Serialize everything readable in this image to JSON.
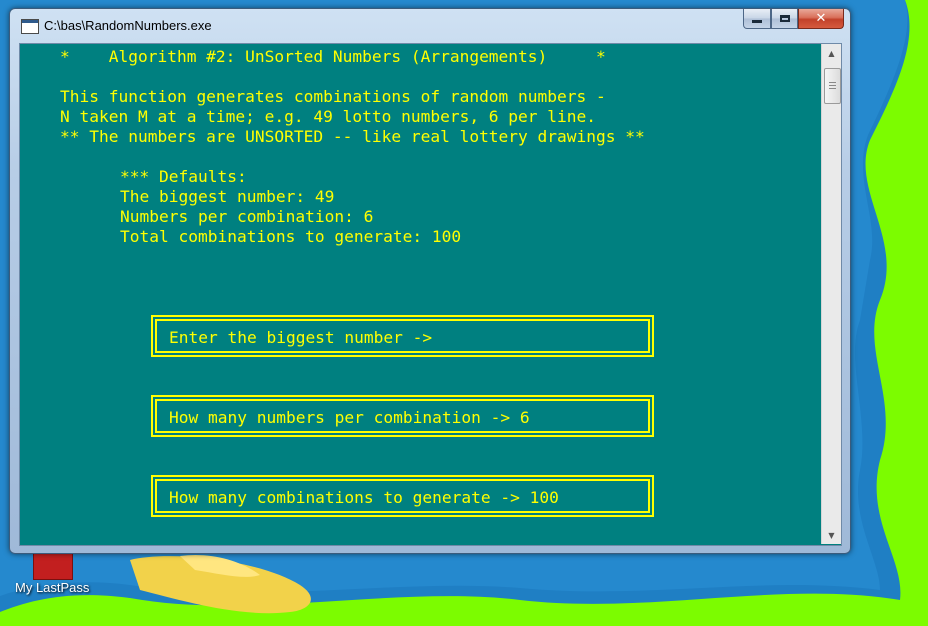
{
  "window": {
    "title": "C:\\bas\\RandomNumbers.exe",
    "close_glyph": "✕",
    "icons": [
      "console-app-icon",
      "minimize-icon",
      "maximize-icon",
      "close-icon"
    ]
  },
  "console": {
    "background": "#008080",
    "text_color": "#ffff00",
    "lines": {
      "header": "*    Algorithm #2: UnSorted Numbers (Arrangements)     *",
      "desc1": "This function generates combinations of random numbers -",
      "desc2": "N taken M at a time; e.g. 49 lotto numbers, 6 per line.",
      "desc3": "** The numbers are UNSORTED -- like real lottery drawings **",
      "defaults_title": "*** Defaults:",
      "default_biggest": "The biggest number: 49",
      "default_per_combo": "Numbers per combination: 6",
      "default_total": "Total combinations to generate: 100"
    },
    "prompts": {
      "biggest": "Enter the biggest number ->",
      "per_combination": "How many numbers per combination -> 6",
      "total": "How many combinations to generate -> 100"
    }
  },
  "scrollbar": {
    "up_glyph": "▲",
    "down_glyph": "▼"
  },
  "desktop": {
    "background_color": "#7cfc00",
    "shortcut_label": "My LastPass"
  }
}
